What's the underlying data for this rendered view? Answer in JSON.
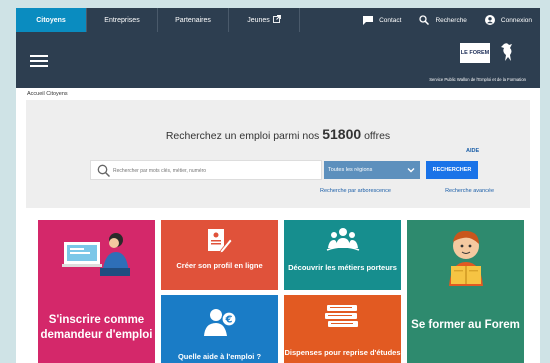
{
  "nav": {
    "tabs": [
      {
        "label": "Citoyens",
        "active": true
      },
      {
        "label": "Entreprises"
      },
      {
        "label": "Partenaires"
      },
      {
        "label": "Jeunes"
      }
    ],
    "contact": "Contact",
    "search": "Recherche",
    "login": "Connexion"
  },
  "header": {
    "logo_text": "LE FOREM",
    "tagline": "Service Public Wallon de l'Emploi et de la Formation"
  },
  "breadcrumb": "Accueil  Citoyens",
  "search": {
    "headline_prefix": "Recherchez un emploi parmi nos",
    "count": "51800",
    "headline_suffix": "offres",
    "aide": "AIDE",
    "placeholder": "Rechercher par mots clés, métier, numéro",
    "region": "Toutes les régions",
    "button": "RECHERCHER",
    "link_tree": "Recherche par arborescence",
    "link_advanced": "Recherche avancée"
  },
  "tiles": {
    "register": "S'inscrire comme demandeur d'emploi",
    "profile": "Créer son profil en ligne",
    "jobs": "Découvrir les métiers porteurs",
    "training": "Se former au Forem",
    "aid": "Quelle aide à l'emploi ?",
    "studies": "Dispenses pour reprise d'études"
  },
  "colors": {
    "nav_bg": "#2d3e50",
    "active_tab": "#0a8cc0",
    "pink": "#d4286a",
    "orange_red": "#e0523a",
    "teal": "#168e8e",
    "green": "#2e8a6e",
    "blue": "#1a7cc6",
    "orange": "#e25a22"
  }
}
